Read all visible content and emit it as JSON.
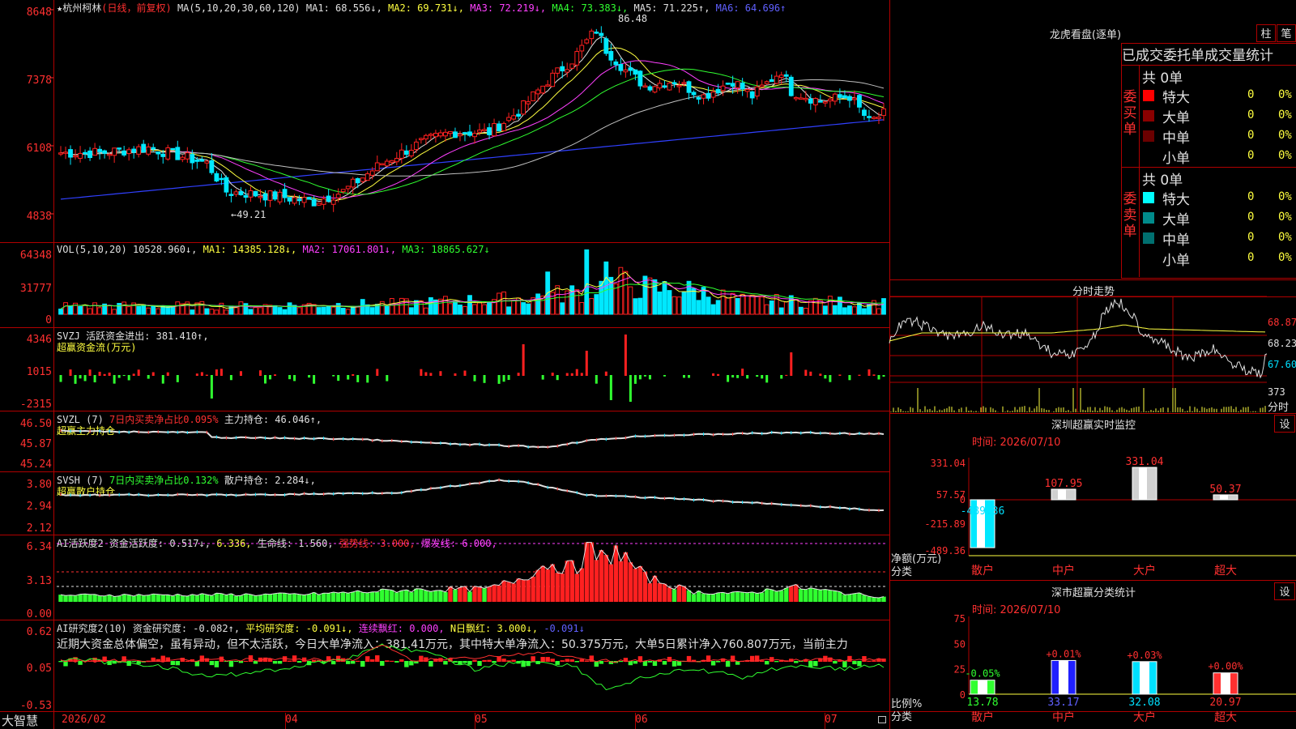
{
  "app": {
    "brand": "大智慧"
  },
  "kline": {
    "header": {
      "star": "★",
      "name": "杭州柯林",
      "mode": "(日线，前复权)",
      "ma_def": "MA(5,10,20,30,60,120)",
      "ma1": "MA1: 68.556↓,",
      "ma2": "MA2: 69.731↓,",
      "ma3": "MA3: 72.219↓,",
      "ma4": "MA4: 73.383↓,",
      "ma5": "MA5: 71.225↑,",
      "ma6": "MA6: 64.696↑"
    },
    "yticks": [
      "8648",
      "7378",
      "6108",
      "4838"
    ],
    "high_label": "86.48",
    "low_label": "←49.21"
  },
  "vol": {
    "header": {
      "def": "VOL(5,10,20)",
      "val": "10528.960↓,",
      "ma1": "MA1: 14385.128↓,",
      "ma2": "MA2: 17061.801↓,",
      "ma3": "MA3: 18865.627↓"
    },
    "yticks": [
      "64348",
      "31777",
      "0"
    ]
  },
  "svzj": {
    "header": {
      "def": "SVZJ",
      "label": "活跃资金进出: 381.410↑,",
      "sub": "超赢资金流(万元)"
    },
    "yticks": [
      "4346",
      "1015",
      "-2315"
    ]
  },
  "svzl": {
    "header": {
      "def": "SVZL (7)",
      "a": "7日内买卖净占比0.095%",
      "b": "主力持仓: 46.046↑,",
      "sub": "超赢主力持仓"
    },
    "yticks": [
      "46.50",
      "45.87",
      "45.24"
    ]
  },
  "svsh": {
    "header": {
      "def": "SVSH (7)",
      "a": "7日内买卖净占比0.132%",
      "b": "散户持仓: 2.284↓,",
      "sub": "超赢散户持仓"
    },
    "yticks": [
      "3.80",
      "2.94",
      "2.12"
    ]
  },
  "ai1": {
    "header": {
      "def": "AI活跃度2",
      "a": "资金活跃度: 0.517↓,",
      "b": "6.336,",
      "c": "生命线: 1.560,",
      "d": "强势线: 3.000,",
      "e": "爆发线: 6.000,"
    },
    "yticks": [
      "6.34",
      "3.13",
      "0.00"
    ]
  },
  "ai2": {
    "header": {
      "def": "AI研究度2(10)",
      "a": "资金研究度: -0.082↑,",
      "b": "平均研究度: -0.091↓,",
      "c": "连续飘红: 0.000,",
      "d": "N日飘红: 3.000↓,",
      "e": "-0.091↓"
    },
    "comment": "近期大资金总体偏空，虽有异动，但不太活跃，今日大单净流入：381.41万元，其中特大单净流入：50.375万元，大单5日累计净入760.807万元，当前主力",
    "yticks": [
      "0.62",
      "0.05",
      "-0.53"
    ]
  },
  "xaxis": {
    "labels": [
      "2026/02",
      "04",
      "05",
      "06",
      "07"
    ]
  },
  "longhu": {
    "title": "龙虎看盘(逐单)",
    "btn1": "柱",
    "btn2": "笔",
    "sub": "已成交委托单成交量统计",
    "buy": {
      "side": "委买单",
      "total": "共 0单",
      "rows": [
        {
          "name": "特大",
          "n": "0",
          "p": "0%",
          "color": "#ff0000"
        },
        {
          "name": "大单",
          "n": "0",
          "p": "0%",
          "color": "#8b0000"
        },
        {
          "name": "中单",
          "n": "0",
          "p": "0%",
          "color": "#6b0000"
        },
        {
          "name": "小单",
          "n": "0",
          "p": "0%",
          "color": "#000000"
        }
      ]
    },
    "sell": {
      "side": "委卖单",
      "total": "共 0单",
      "rows": [
        {
          "name": "特大",
          "n": "0",
          "p": "0%",
          "color": "#00ffff"
        },
        {
          "name": "大单",
          "n": "0",
          "p": "0%",
          "color": "#008b8b"
        },
        {
          "name": "中单",
          "n": "0",
          "p": "0%",
          "color": "#007070"
        },
        {
          "name": "小单",
          "n": "0",
          "p": "0%",
          "color": "#000000"
        }
      ]
    }
  },
  "intraday": {
    "title": "分时走势",
    "p1": "68.87",
    "p2": "68.23",
    "p3": "67.60",
    "v1": "373",
    "v2": "分时"
  },
  "monitor": {
    "title": "深圳超赢实时监控",
    "btn": "设",
    "time": "时间: 2026/07/10",
    "yticks": [
      "331.04",
      "57.57",
      "0",
      "-215.89",
      "-489.36"
    ],
    "ylabel1": "净额(万元)",
    "ylabel2": "分类",
    "bars": [
      {
        "cat": "散户",
        "v": -489.36,
        "label": "-489.36"
      },
      {
        "cat": "中户",
        "v": 107.95,
        "label": "107.95"
      },
      {
        "cat": "大户",
        "v": 331.04,
        "label": "331.04"
      },
      {
        "cat": "超大",
        "v": 50.37,
        "label": "50.37"
      }
    ]
  },
  "classify": {
    "title": "深市超赢分类统计",
    "btn": "设",
    "time": "时间: 2026/07/10",
    "yticks": [
      "75",
      "50",
      "25",
      "0"
    ],
    "ylabel1": "比例%",
    "ylabel2": "分类",
    "bars": [
      {
        "cat": "散户",
        "v": 13.78,
        "label": "13.78",
        "chg": "-0.05%",
        "color": "#30ff30"
      },
      {
        "cat": "中户",
        "v": 33.17,
        "label": "33.17",
        "chg": "+0.01%",
        "color": "#2020ff"
      },
      {
        "cat": "大户",
        "v": 32.08,
        "label": "32.08",
        "chg": "+0.03%",
        "color": "#00e0ff"
      },
      {
        "cat": "超大",
        "v": 20.97,
        "label": "20.97",
        "chg": "+0.00%",
        "color": "#ff3030"
      }
    ]
  }
}
